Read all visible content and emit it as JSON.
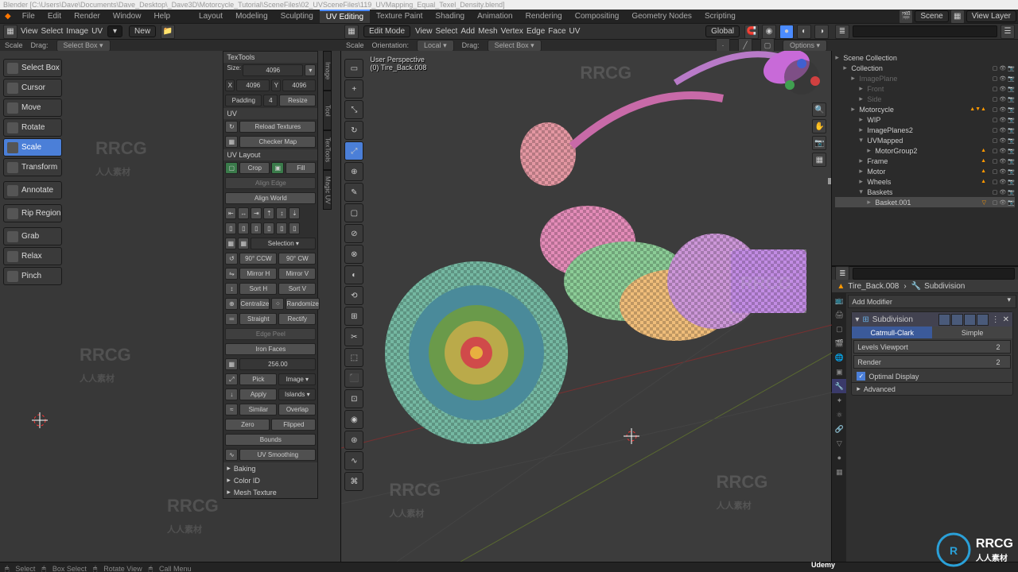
{
  "title_bar": "Blender  [C:\\Users\\Dave\\Documents\\Dave_Desktop\\_Dave3D\\Motorcycle_Tutorial\\SceneFiles\\02_UVSceneFiles\\119_UVMapping_Equal_Texel_Density.blend]",
  "menu": {
    "items": [
      "File",
      "Edit",
      "Render",
      "Window",
      "Help"
    ]
  },
  "workspaces": [
    "Layout",
    "Modeling",
    "Sculpting",
    "UV Editing",
    "Texture Paint",
    "Shading",
    "Animation",
    "Rendering",
    "Compositing",
    "Geometry Nodes",
    "Scripting"
  ],
  "workspace_active": "UV Editing",
  "scene_name": "Scene",
  "viewlayer_name": "View Layer",
  "toolbar_left": {
    "menus": [
      "View",
      "Select",
      "Image",
      "UV"
    ],
    "new": "New"
  },
  "header_left": {
    "items": [
      "Scale",
      "Drag:",
      "Select Box ▾"
    ]
  },
  "toolbar_right": {
    "mode": "Edit Mode",
    "menus": [
      "View",
      "Select",
      "Add",
      "Mesh",
      "Vertex",
      "Edge",
      "Face",
      "UV"
    ],
    "orient": "Global"
  },
  "header_right": {
    "items": [
      "Scale",
      "Orientation:",
      "Local ▾",
      "Drag:",
      "Select Box ▾"
    ],
    "options": "Options ▾"
  },
  "left_tools": [
    {
      "label": "Select Box",
      "on": false
    },
    {
      "label": "Cursor",
      "on": false
    },
    {
      "label": "Move",
      "on": false
    },
    {
      "label": "Rotate",
      "on": false
    },
    {
      "label": "Scale",
      "on": true
    },
    {
      "label": "Transform",
      "on": false
    },
    {
      "label": "Annotate",
      "on": false
    },
    {
      "label": "Rip Region",
      "on": false
    },
    {
      "label": "Grab",
      "on": false
    },
    {
      "label": "Relax",
      "on": false
    },
    {
      "label": "Pinch",
      "on": false
    }
  ],
  "side_tabs": [
    "Image",
    "Tool",
    "TexTools",
    "Magic UV"
  ],
  "textools": {
    "title": "TexTools",
    "size_label": "Size:",
    "size": "4096",
    "x": "X",
    "y": "Y",
    "xv": "4096",
    "yv": "4096",
    "padding_label": "Padding",
    "padding": "4",
    "resize": "Resize",
    "uv_label": "UV",
    "reload": "Reload Textures",
    "checker": "Checker Map"
  },
  "uvlayout": {
    "title": "UV Layout",
    "crop": "Crop",
    "fill": "Fill",
    "align_edge": "Align Edge",
    "align_world": "Align World",
    "selection": "Selection ▾",
    "ccw": "90° CCW",
    "cw": "90° CW",
    "mh": "Mirror H",
    "mv": "Mirror V",
    "sh": "Sort H",
    "sv": "Sort V",
    "centralize": "Centralize",
    "randomize": "Randomize",
    "straight": "Straight",
    "rectify": "Rectify",
    "edgepeel": "Edge Peel",
    "iron": "Iron Faces",
    "texel": "256.00",
    "pick": "Pick",
    "image": "Image ▾",
    "apply": "Apply",
    "islands": "Islands ▾",
    "similar": "Similar",
    "overlap": "Overlap",
    "zero": "Zero",
    "flipped": "Flipped",
    "bounds": "Bounds",
    "smoothing": "UV Smoothing"
  },
  "collapsed_panels": [
    "Baking",
    "Color ID",
    "Mesh Texture"
  ],
  "viewport_overlay": {
    "line1": "User Perspective",
    "line2": "(0) Tire_Back.008"
  },
  "outliner": {
    "hdr": "Scene Collection",
    "rows": [
      {
        "ind": 1,
        "name": "Collection"
      },
      {
        "ind": 2,
        "name": "ImagePlane",
        "dim": true
      },
      {
        "ind": 3,
        "name": "Front",
        "dim": true
      },
      {
        "ind": 3,
        "name": "Side",
        "dim": true
      },
      {
        "ind": 2,
        "name": "Motorcycle",
        "tri": "▲▼▲"
      },
      {
        "ind": 3,
        "name": "WIP"
      },
      {
        "ind": 3,
        "name": "ImagePlanes2"
      },
      {
        "ind": 3,
        "name": "UVMapped",
        "exp": true
      },
      {
        "ind": 4,
        "name": "MotorGroup2",
        "tri": "▲"
      },
      {
        "ind": 3,
        "name": "Frame",
        "tri": "▲"
      },
      {
        "ind": 3,
        "name": "Motor",
        "tri": "▲"
      },
      {
        "ind": 3,
        "name": "Wheels",
        "tri": "▲"
      },
      {
        "ind": 3,
        "name": "Baskets",
        "exp": true
      },
      {
        "ind": 4,
        "name": "Basket.001",
        "sel": true,
        "tri": "▽"
      }
    ]
  },
  "props": {
    "object": "Tire_Back.008",
    "modifier_subhdr": "Subdivision",
    "add": "Add Modifier",
    "mod_name": "Subdivision",
    "catmull": "Catmull-Clark",
    "simple": "Simple",
    "levels_vp": "Levels Viewport",
    "levels_vp_v": "2",
    "render": "Render",
    "render_v": "2",
    "optimal": "Optimal Display",
    "advanced": "Advanced"
  },
  "status": {
    "items": [
      "Select",
      "Box Select",
      "Rotate View",
      "Call Menu"
    ],
    "brand": "Udemy"
  },
  "watermark": "RRCG\n人人素材"
}
